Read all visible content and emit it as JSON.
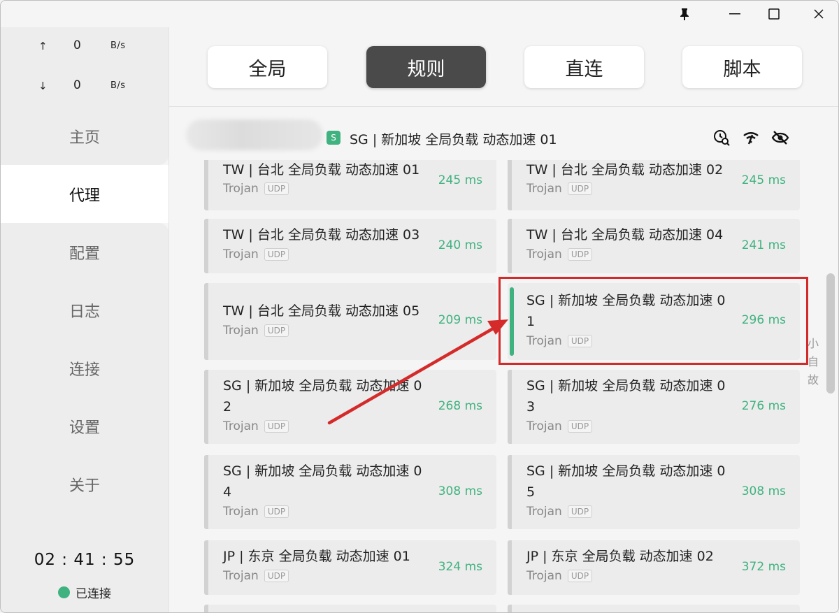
{
  "traffic": {
    "up_arrow": "↑",
    "up_value": "0",
    "up_unit": "B/s",
    "down_arrow": "↓",
    "down_value": "0",
    "down_unit": "B/s"
  },
  "nav": {
    "items": [
      {
        "label": "主页"
      },
      {
        "label": "代理"
      },
      {
        "label": "配置"
      },
      {
        "label": "日志"
      },
      {
        "label": "连接"
      },
      {
        "label": "设置"
      },
      {
        "label": "关于"
      }
    ],
    "active": "代理"
  },
  "footer": {
    "timer": "02 : 41 : 55",
    "status": "已连接"
  },
  "modes": [
    {
      "label": "全局"
    },
    {
      "label": "规则",
      "active": true
    },
    {
      "label": "直连"
    },
    {
      "label": "脚本"
    }
  ],
  "group": {
    "selected_badge": "S",
    "selected_name": "SG | 新加坡 全局负载 动态加速 01",
    "icons": [
      "latency-test-icon",
      "wifi-icon",
      "hide-icon"
    ]
  },
  "proxies": [
    {
      "name": "TW | 台北 全局负载 动态加速 01",
      "protocol": "Trojan",
      "tag": "UDP",
      "latency": "245 ms"
    },
    {
      "name": "TW | 台北 全局负载 动态加速 02",
      "protocol": "Trojan",
      "tag": "UDP",
      "latency": "245 ms"
    },
    {
      "name": "TW | 台北 全局负载 动态加速 03",
      "protocol": "Trojan",
      "tag": "UDP",
      "latency": "240 ms"
    },
    {
      "name": "TW | 台北 全局负载 动态加速 04",
      "protocol": "Trojan",
      "tag": "UDP",
      "latency": "241 ms"
    },
    {
      "name": "TW | 台北 全局负载 动态加速 05",
      "protocol": "Trojan",
      "tag": "UDP",
      "latency": "209 ms"
    },
    {
      "name": "SG | 新加坡 全局负载 动态加速 0\n1",
      "protocol": "Trojan",
      "tag": "UDP",
      "latency": "296 ms",
      "selected": true
    },
    {
      "name": "SG | 新加坡 全局负载 动态加速 0\n2",
      "protocol": "Trojan",
      "tag": "UDP",
      "latency": "268 ms"
    },
    {
      "name": "SG | 新加坡 全局负载 动态加速 0\n3",
      "protocol": "Trojan",
      "tag": "UDP",
      "latency": "276 ms"
    },
    {
      "name": "SG | 新加坡 全局负载 动态加速 0\n4",
      "protocol": "Trojan",
      "tag": "UDP",
      "latency": "308 ms"
    },
    {
      "name": "SG | 新加坡 全局负载 动态加速 0\n5",
      "protocol": "Trojan",
      "tag": "UDP",
      "latency": "308 ms"
    },
    {
      "name": "JP | 东京 全局负载 动态加速 01",
      "protocol": "Trojan",
      "tag": "UDP",
      "latency": "324 ms"
    },
    {
      "name": "JP | 东京 全局负载 动态加速 02",
      "protocol": "Trojan",
      "tag": "UDP",
      "latency": "372 ms"
    }
  ],
  "side_text": [
    "小",
    "自",
    "故"
  ],
  "colors": {
    "accent": "#3fb27f",
    "annotation": "#d42a2a",
    "active_mode": "#4a4a4a"
  }
}
